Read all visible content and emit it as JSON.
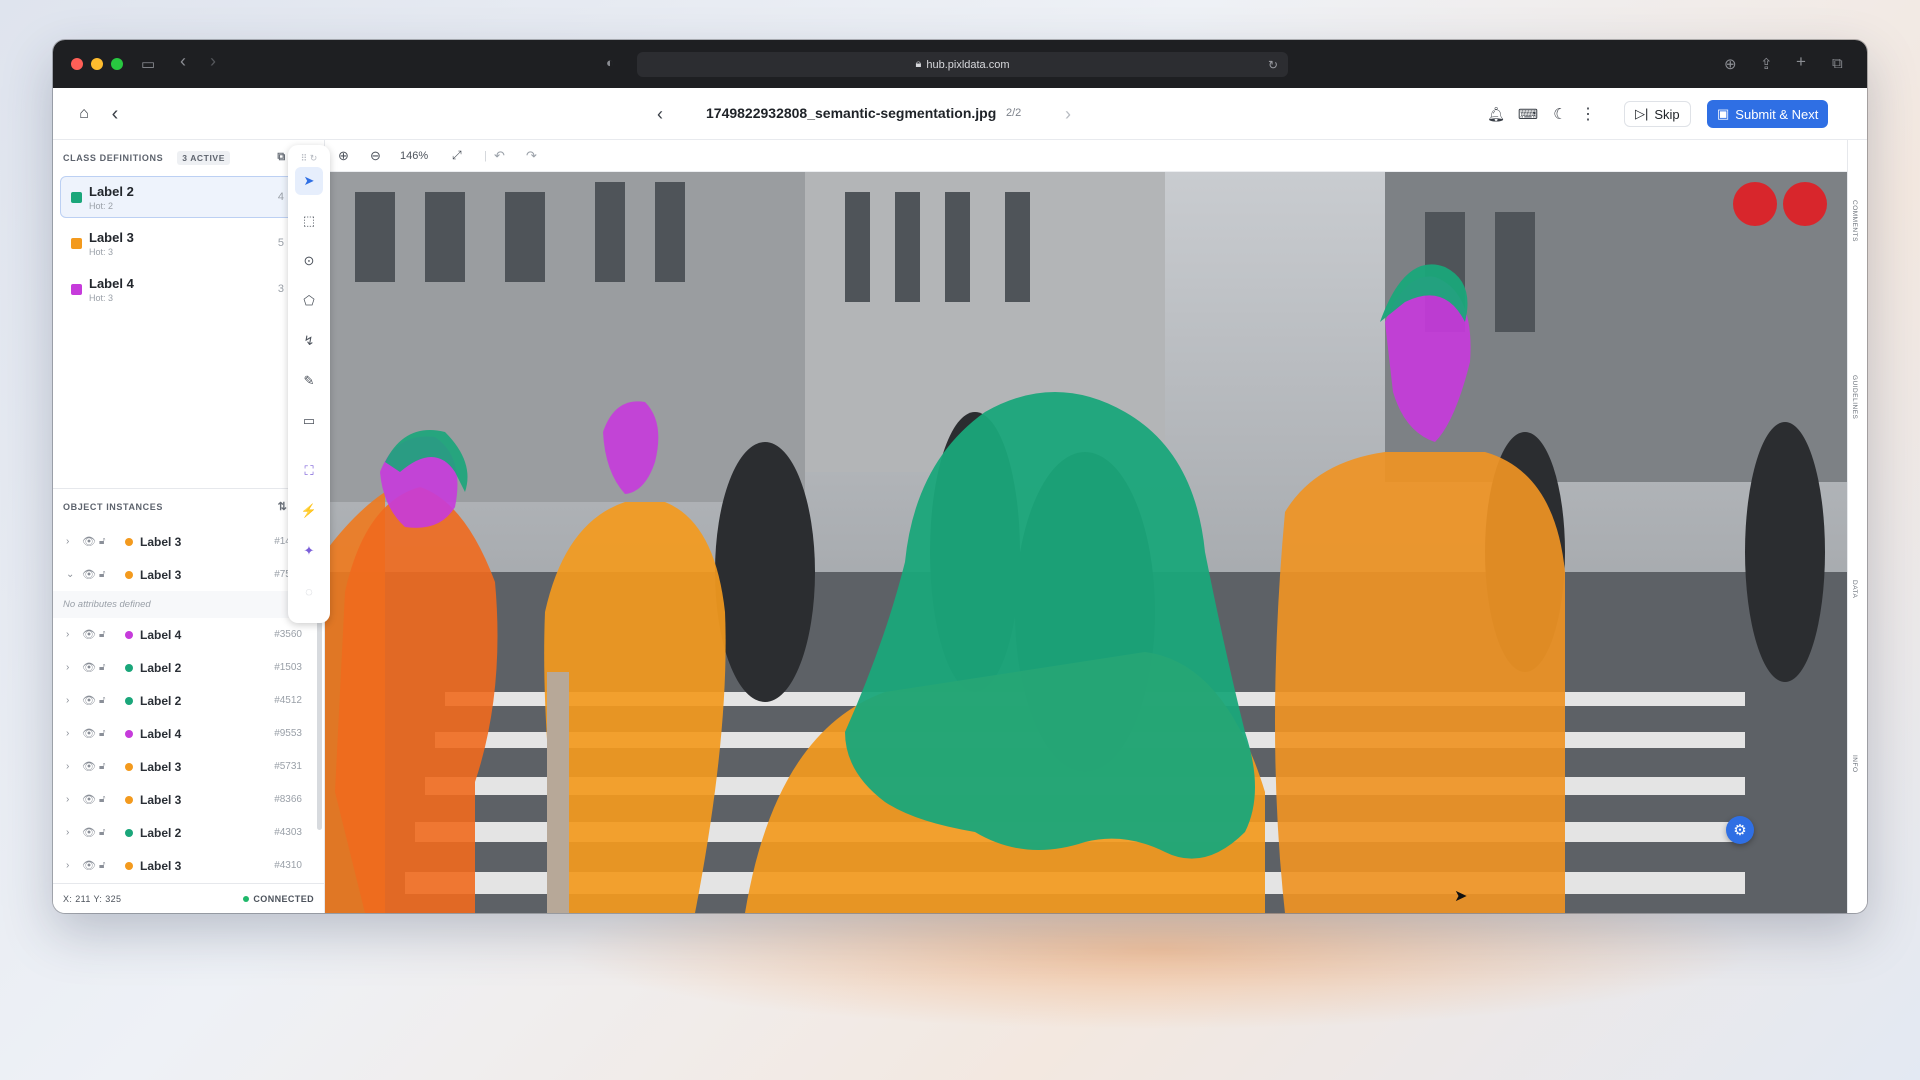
{
  "browser": {
    "url": "hub.pixldata.com"
  },
  "header": {
    "file_name": "1749822932808_semantic-segmentation.jpg",
    "pager": "2/2",
    "skip_label": "Skip",
    "submit_label": "Submit & Next"
  },
  "class_definitions": {
    "title": "CLASS DEFINITIONS",
    "badge": "3 ACTIVE",
    "items": [
      {
        "label": "Label 2",
        "hotkey": "Hot: 2",
        "count": "4",
        "color": "#1aa67a"
      },
      {
        "label": "Label 3",
        "hotkey": "Hot: 3",
        "count": "5",
        "color": "#f39a1e"
      },
      {
        "label": "Label 4",
        "hotkey": "Hot: 3",
        "count": "3",
        "color": "#c63bdb"
      }
    ]
  },
  "object_instances": {
    "title": "OBJECT INSTANCES",
    "no_attributes": "No attributes defined",
    "rows": [
      {
        "label": "Label 3",
        "id": "#1445",
        "color": "#f39a1e",
        "expanded": false
      },
      {
        "label": "Label 3",
        "id": "#7538",
        "color": "#f39a1e",
        "expanded": true
      },
      {
        "label": "Label 4",
        "id": "#3560",
        "color": "#c63bdb",
        "expanded": false
      },
      {
        "label": "Label 2",
        "id": "#1503",
        "color": "#1aa67a",
        "expanded": false
      },
      {
        "label": "Label 2",
        "id": "#4512",
        "color": "#1aa67a",
        "expanded": false
      },
      {
        "label": "Label 4",
        "id": "#9553",
        "color": "#c63bdb",
        "expanded": false
      },
      {
        "label": "Label 3",
        "id": "#5731",
        "color": "#f39a1e",
        "expanded": false
      },
      {
        "label": "Label 3",
        "id": "#8366",
        "color": "#f39a1e",
        "expanded": false
      },
      {
        "label": "Label 2",
        "id": "#4303",
        "color": "#1aa67a",
        "expanded": false
      },
      {
        "label": "Label 3",
        "id": "#4310",
        "color": "#f39a1e",
        "expanded": false
      }
    ]
  },
  "status": {
    "coords": "X: 211 Y: 325",
    "connection": "CONNECTED"
  },
  "canvas_toolbar": {
    "zoom": "146%"
  },
  "right_rail": [
    "COMMENTS",
    "GUIDELINES",
    "DATA",
    "INFO"
  ],
  "colors": {
    "accent": "#2f6fe4",
    "label2": "#1aa67a",
    "label3": "#f39a1e",
    "label4": "#c63bdb"
  }
}
